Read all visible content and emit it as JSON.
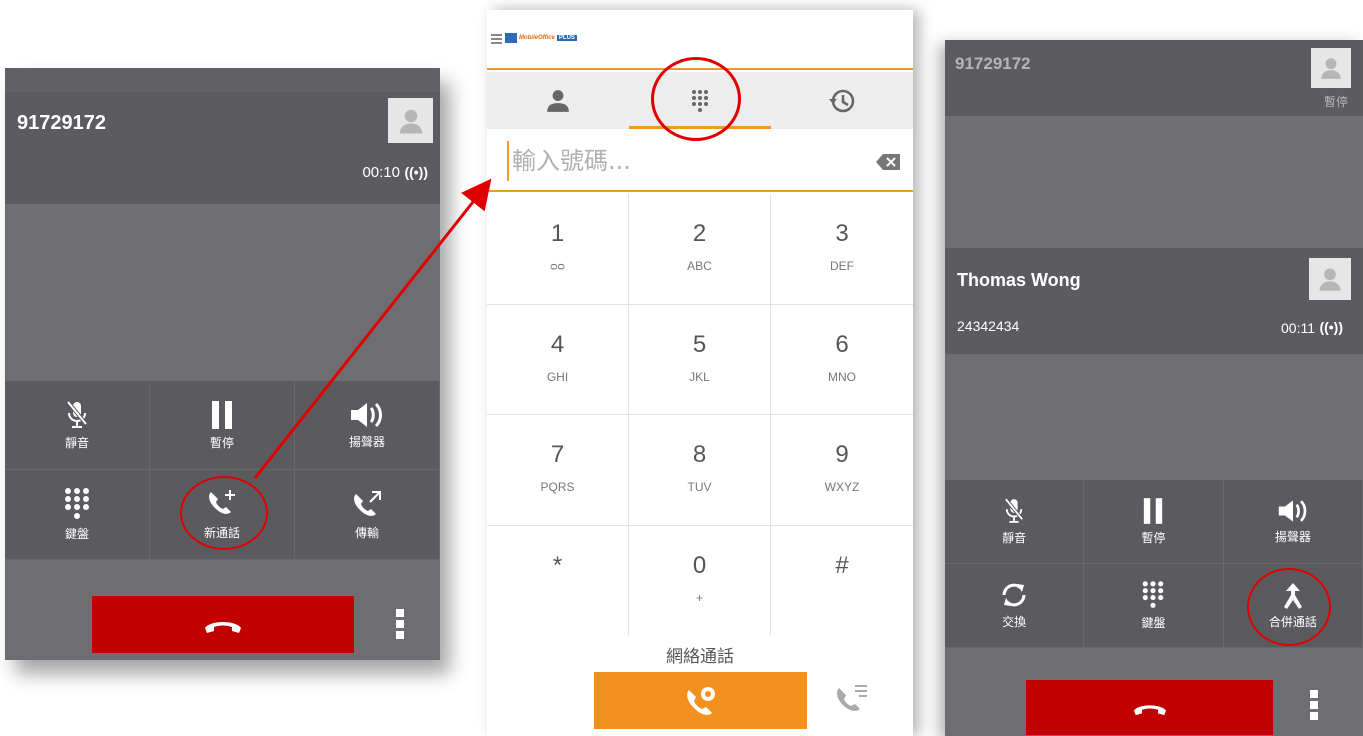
{
  "left_call": {
    "number": "91729172",
    "duration": "00:10",
    "signal": "((•))",
    "controls": [
      {
        "label": "靜音",
        "icon": "mic-off-icon"
      },
      {
        "label": "暫停",
        "icon": "pause-icon"
      },
      {
        "label": "揚聲器",
        "icon": "speaker-icon"
      },
      {
        "label": "鍵盤",
        "icon": "keypad-icon"
      },
      {
        "label": "新通話",
        "icon": "add-call-icon"
      },
      {
        "label": "傳輸",
        "icon": "transfer-icon"
      }
    ]
  },
  "dialer": {
    "app_logo": "MobileOffice",
    "app_logo_tag": "PLUS",
    "tabs": [
      {
        "name": "contacts",
        "icon": "person-icon"
      },
      {
        "name": "dialpad",
        "icon": "dialpad-icon",
        "active": true
      },
      {
        "name": "history",
        "icon": "history-icon"
      }
    ],
    "input_placeholder": "輸入號碼...",
    "keys": [
      {
        "digit": "1",
        "letters": "ᴑᴑ"
      },
      {
        "digit": "2",
        "letters": "ABC"
      },
      {
        "digit": "3",
        "letters": "DEF"
      },
      {
        "digit": "4",
        "letters": "GHI"
      },
      {
        "digit": "5",
        "letters": "JKL"
      },
      {
        "digit": "6",
        "letters": "MNO"
      },
      {
        "digit": "7",
        "letters": "PQRS"
      },
      {
        "digit": "8",
        "letters": "TUV"
      },
      {
        "digit": "9",
        "letters": "WXYZ"
      },
      {
        "digit": "*",
        "letters": ""
      },
      {
        "digit": "0",
        "letters": "+"
      },
      {
        "digit": "#",
        "letters": ""
      }
    ],
    "call_mode_label": "網絡通話"
  },
  "right_call": {
    "held_number": "91729172",
    "held_label": "暫停",
    "active_name": "Thomas Wong",
    "active_number": "24342434",
    "duration": "00:11",
    "signal": "((•))",
    "controls": [
      {
        "label": "靜音",
        "icon": "mic-off-icon"
      },
      {
        "label": "暫停",
        "icon": "pause-icon"
      },
      {
        "label": "揚聲器",
        "icon": "speaker-icon"
      },
      {
        "label": "交換",
        "icon": "swap-icon"
      },
      {
        "label": "鍵盤",
        "icon": "keypad-icon"
      },
      {
        "label": "合併通話",
        "icon": "merge-icon"
      }
    ]
  },
  "colors": {
    "accent_orange": "#f39a1d",
    "end_call_red": "#c10000",
    "annotation_red": "#e00000"
  }
}
